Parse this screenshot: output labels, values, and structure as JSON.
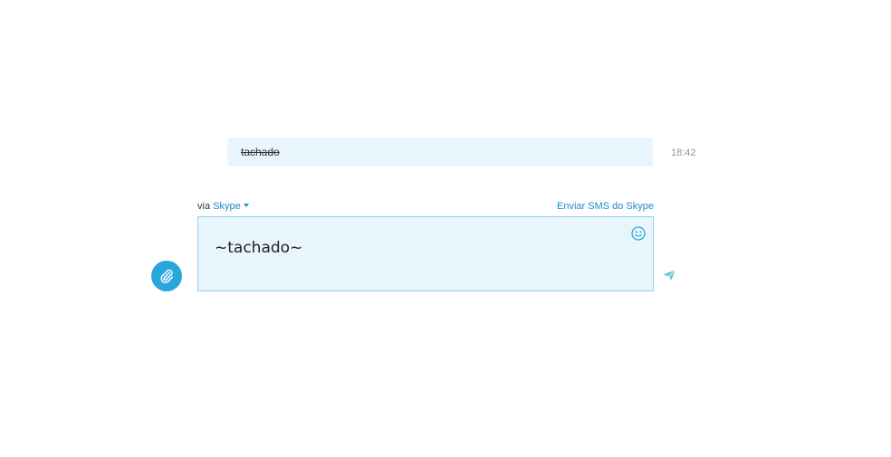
{
  "conversation": {
    "message": {
      "text": "tachado",
      "time": "18:42"
    }
  },
  "compose": {
    "via_label": "via",
    "via_service": "Skype",
    "sms_link": "Enviar SMS do Skype",
    "input_value": "~tachado~"
  },
  "icons": {
    "attach": "paperclip-icon",
    "emoji": "smiley-icon",
    "send": "send-icon",
    "dropdown": "chevron-down-icon"
  },
  "colors": {
    "accent": "#2aa6db",
    "link": "#1c8cc9",
    "bubble_bg": "#e8f5fc",
    "input_border": "#8fd0ec",
    "time_text": "#8a9aa5"
  }
}
